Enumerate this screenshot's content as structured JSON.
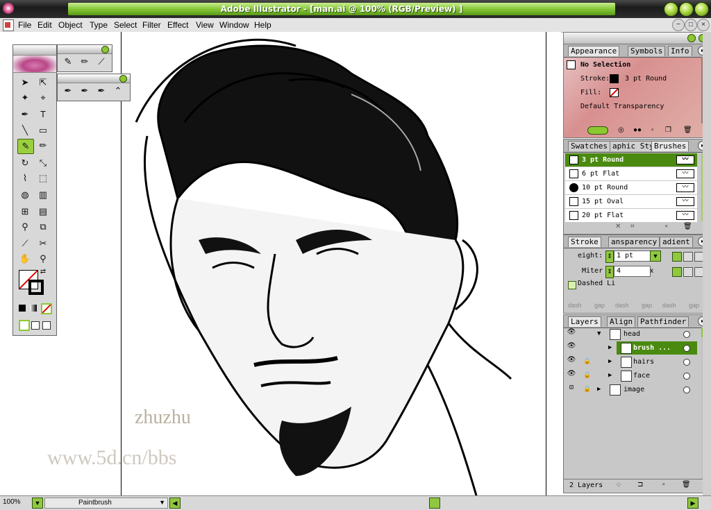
{
  "window": {
    "title": "Adobe Illustrator - [man.ai @ 100% (RGB/Preview) ]"
  },
  "menu": [
    "File",
    "Edit",
    "Object",
    "Type",
    "Select",
    "Filter",
    "Effect",
    "View",
    "Window",
    "Help"
  ],
  "watermarks": {
    "line1": "zhuzhu",
    "line2": "www.5d.cn/bbs"
  },
  "appearance": {
    "tabs": [
      "Appearance",
      "Symbols",
      "Info"
    ],
    "selection": "No Selection",
    "stroke_label": "Stroke:",
    "stroke_value": "3 pt Round",
    "fill_label": "Fill:",
    "transparency": "Default Transparency"
  },
  "brushes": {
    "tabs": [
      "Swatches",
      "aphic Sty",
      "Brushes"
    ],
    "items": [
      "3 pt Round",
      "6 pt Flat",
      "10 pt Round",
      "15 pt Oval",
      "20 pt Flat"
    ]
  },
  "stroke": {
    "tabs": [
      "Stroke",
      "ansparency",
      "adient"
    ],
    "weight_label": "eight:",
    "weight_value": "1 pt",
    "miter_label": "Miter",
    "miter_value": "4",
    "miter_unit": "x",
    "dashed_label": "Dashed Li",
    "dash_labels": [
      "dash",
      "gap",
      "dash",
      "gap",
      "dash",
      "gap"
    ]
  },
  "layers": {
    "tabs": [
      "Layers",
      "Align",
      "Pathfinder"
    ],
    "items": [
      "head",
      "brush ...",
      "hairs",
      "face",
      "image"
    ],
    "count": "2 Layers"
  },
  "status": {
    "zoom": "100%",
    "tool": "Paintbrush"
  },
  "colors": {
    "accent_green": "#8cc830",
    "title_green": "#86c838",
    "selected_row": "#4a8a10"
  }
}
